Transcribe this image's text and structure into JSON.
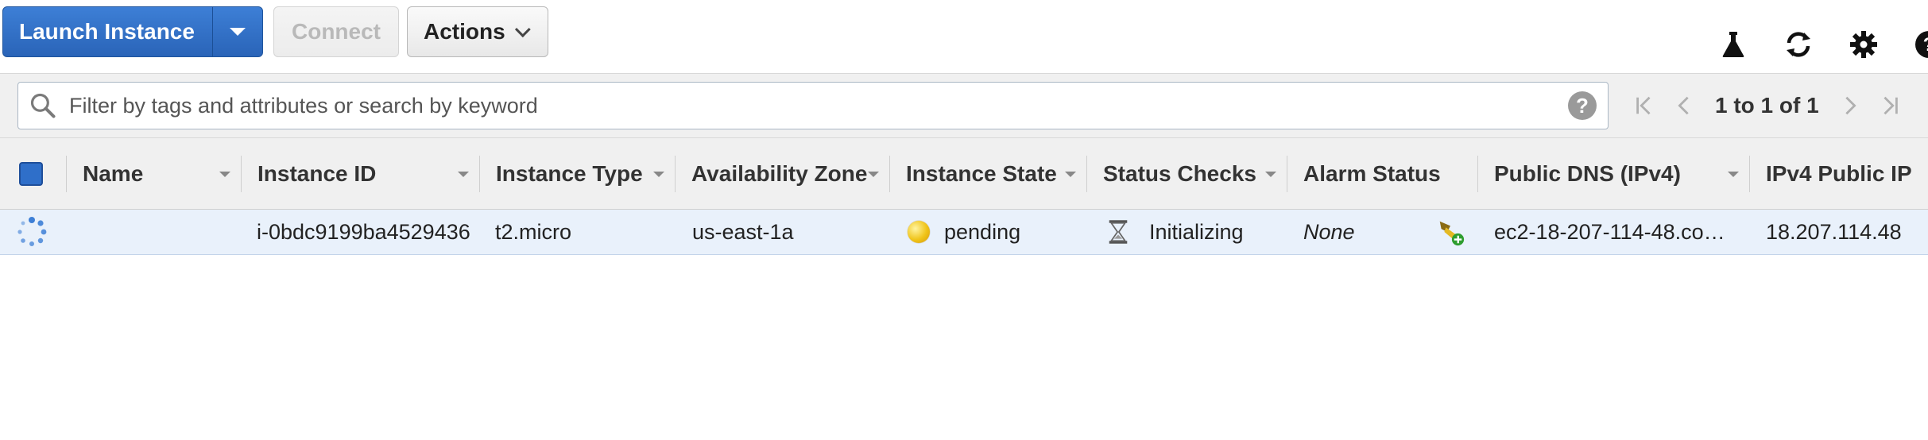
{
  "toolbar": {
    "launch_label": "Launch Instance",
    "connect_label": "Connect",
    "actions_label": "Actions",
    "icons": [
      "flask-icon",
      "refresh-icon",
      "gear-icon",
      "help-icon"
    ]
  },
  "search": {
    "placeholder": "Filter by tags and attributes or search by keyword",
    "value": ""
  },
  "pager": {
    "text": "1 to 1 of 1"
  },
  "table": {
    "columns": [
      "Name",
      "Instance ID",
      "Instance Type",
      "Availability Zone",
      "Instance State",
      "Status Checks",
      "Alarm Status",
      "Public DNS (IPv4)",
      "IPv4 Public IP"
    ],
    "rows": [
      {
        "name": "",
        "instance_id": "i-0bdc9199ba4529436",
        "instance_type": "t2.micro",
        "availability_zone": "us-east-1a",
        "instance_state": "pending",
        "status_checks": "Initializing",
        "alarm_status": "None",
        "public_dns": "ec2-18-207-114-48.co…",
        "public_ip": "18.207.114.48"
      }
    ]
  },
  "colors": {
    "primary": "#2f6fc9",
    "state_pending": "#f0c419",
    "row_selected": "#e9f1fb"
  }
}
